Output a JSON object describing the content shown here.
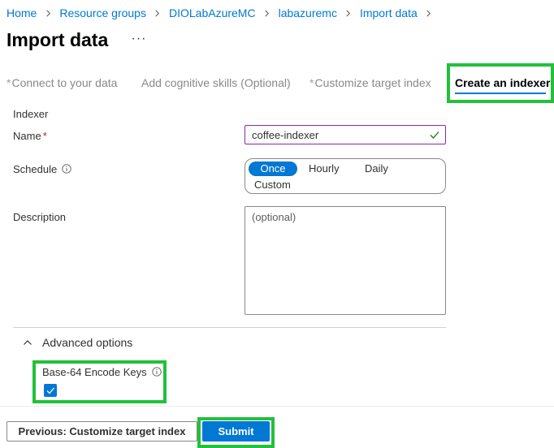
{
  "breadcrumb": {
    "items": [
      "Home",
      "Resource groups",
      "DIOLabAzureMC",
      "labazuremc",
      "Import data"
    ]
  },
  "page": {
    "title": "Import data",
    "more_label": "···"
  },
  "tabs": [
    {
      "label": "Connect to your data",
      "required_marker": "*",
      "active": false
    },
    {
      "label": "Add cognitive skills (Optional)",
      "required_marker": "",
      "active": false
    },
    {
      "label": "Customize target index",
      "required_marker": "*",
      "active": false
    },
    {
      "label": "Create an indexer",
      "required_marker": "",
      "active": true
    }
  ],
  "form": {
    "section_title": "Indexer",
    "name": {
      "label": "Name",
      "required_marker": "*",
      "value": "coffee-indexer"
    },
    "schedule": {
      "label": "Schedule",
      "options": [
        "Once",
        "Hourly",
        "Daily",
        "Custom"
      ],
      "selected": "Once"
    },
    "description": {
      "label": "Description",
      "placeholder": "(optional)"
    },
    "advanced": {
      "label": "Advanced options",
      "expanded": true,
      "base64": {
        "label": "Base-64 Encode Keys",
        "checked": true
      }
    }
  },
  "footer": {
    "previous_label": "Previous: Customize target index",
    "submit_label": "Submit"
  },
  "colors": {
    "accent": "#0078d4",
    "highlight": "#22c13b",
    "valid": "#107c10",
    "name_border": "#8a2b9a",
    "required": "#a4262c"
  },
  "icons": {
    "breadcrumb_separator": "chevron-right-icon",
    "info": "info-icon",
    "valid": "checkmark-icon",
    "advanced_toggle": "chevron-up-icon",
    "checkbox": "checkmark-icon"
  }
}
